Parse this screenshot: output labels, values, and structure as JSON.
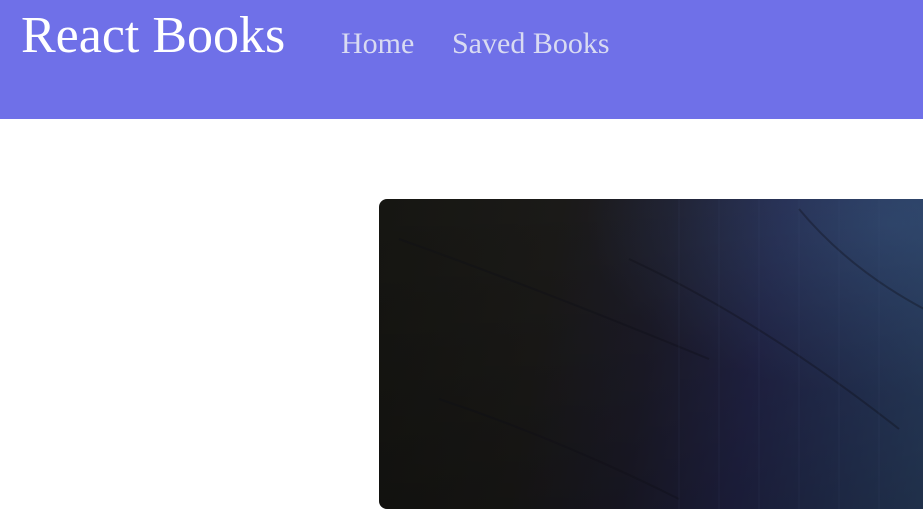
{
  "navbar": {
    "brand": "React Books",
    "links": [
      {
        "label": "Home"
      },
      {
        "label": "Saved Books"
      }
    ]
  },
  "colors": {
    "navbar_background": "#6f70e8",
    "brand_text": "#ffffff",
    "nav_link_text": "#d9dbf2",
    "page_background": "#ffffff"
  },
  "hero": {
    "image": "dark-blue-textured-photo"
  }
}
